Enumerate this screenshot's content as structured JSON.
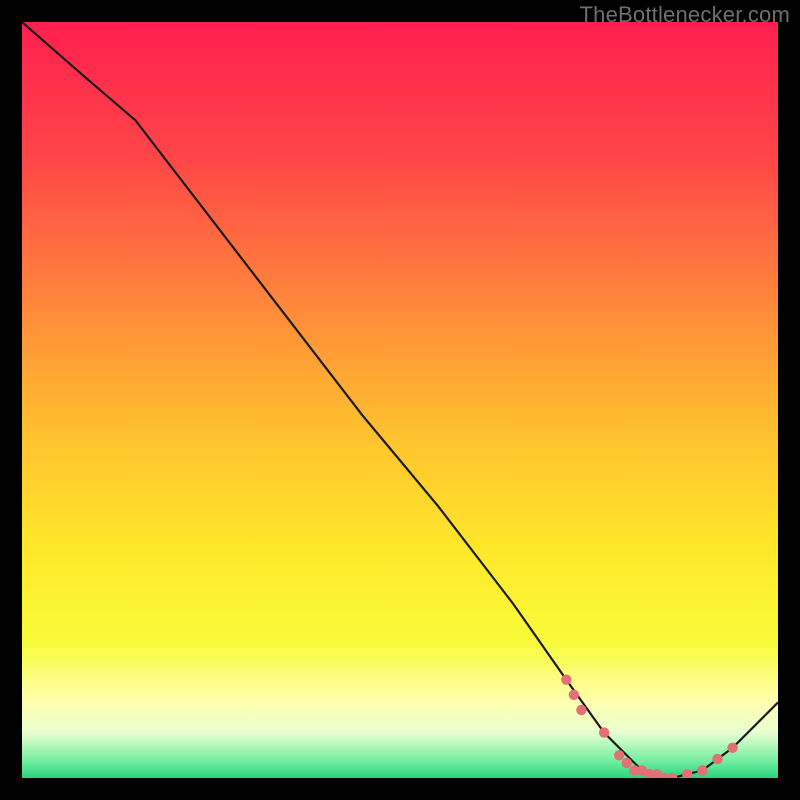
{
  "watermark": "TheBottlenecker.com",
  "chart_data": {
    "type": "line",
    "title": "",
    "xlabel": "",
    "ylabel": "",
    "xlim": [
      0,
      100
    ],
    "ylim": [
      0,
      100
    ],
    "background": "rainbow-vertical",
    "series": [
      {
        "name": "curve",
        "x": [
          0,
          8,
          15,
          25,
          35,
          45,
          55,
          65,
          72,
          77,
          82,
          86,
          90,
          94,
          100
        ],
        "values": [
          100,
          93,
          87,
          74,
          61,
          48,
          36,
          23,
          13,
          6,
          1,
          0,
          1,
          4,
          10
        ]
      }
    ],
    "markers": {
      "name": "dotted-bottom",
      "color": "#e46f74",
      "x": [
        72,
        73,
        74,
        77,
        79,
        80,
        81,
        82,
        83,
        84,
        85,
        86,
        88,
        90,
        92,
        94
      ],
      "values": [
        13,
        11,
        9,
        6,
        3,
        2,
        1,
        1,
        0.5,
        0.5,
        0,
        0,
        0.5,
        1,
        2.5,
        4
      ]
    }
  },
  "colors": {
    "gradient_stops": [
      {
        "offset": 0.0,
        "color": "#ff1f4f"
      },
      {
        "offset": 0.18,
        "color": "#ff4648"
      },
      {
        "offset": 0.38,
        "color": "#ff8a3a"
      },
      {
        "offset": 0.55,
        "color": "#ffc32e"
      },
      {
        "offset": 0.7,
        "color": "#ffe82a"
      },
      {
        "offset": 0.82,
        "color": "#f8fb3a"
      },
      {
        "offset": 0.9,
        "color": "#ffffb0"
      },
      {
        "offset": 0.94,
        "color": "#e8ffd0"
      },
      {
        "offset": 0.975,
        "color": "#7bf0a3"
      },
      {
        "offset": 1.0,
        "color": "#28d47e"
      }
    ],
    "line": "#1a1a1a",
    "marker": "#e46f74"
  }
}
